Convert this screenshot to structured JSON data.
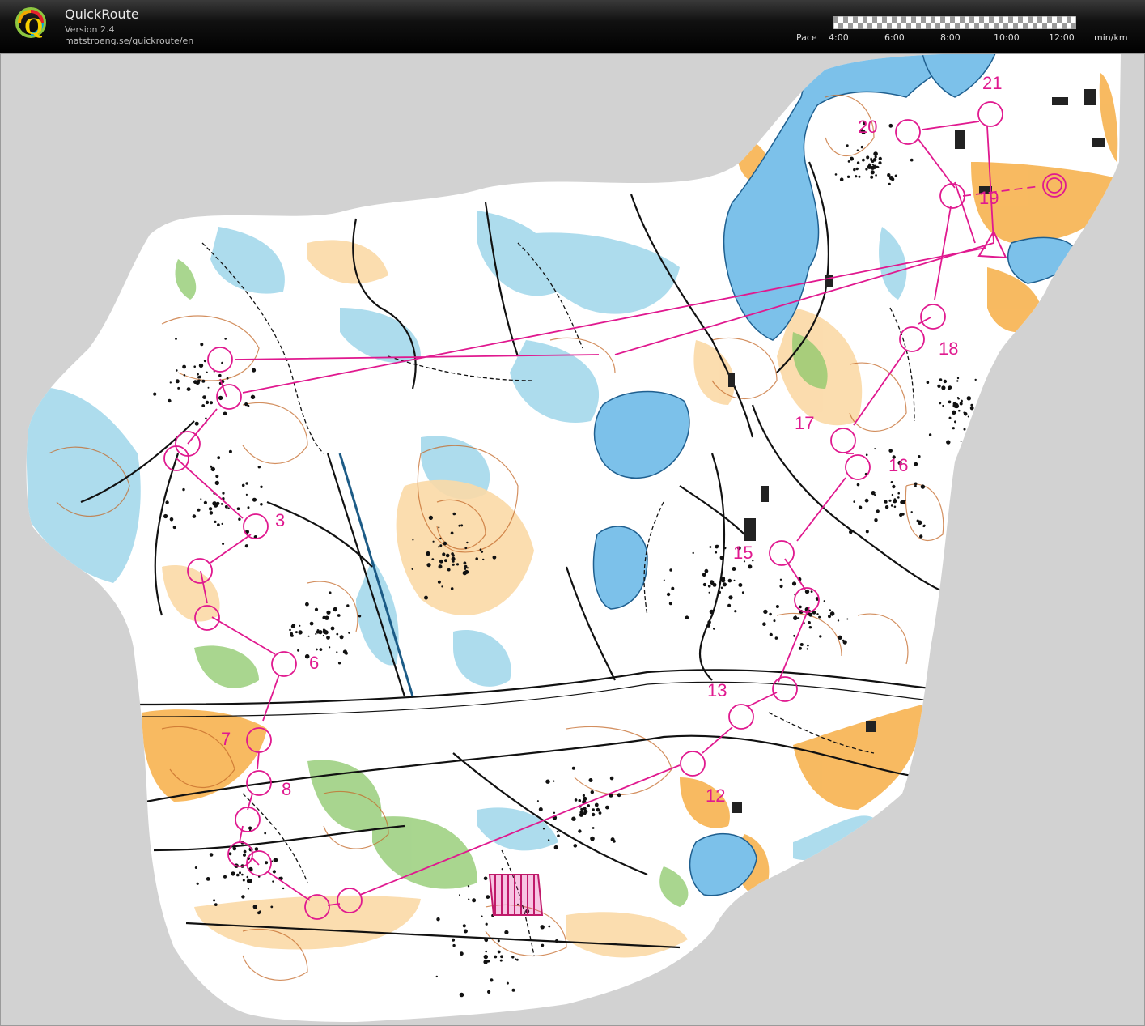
{
  "app": {
    "title": "QuickRoute",
    "version": "Version 2.4",
    "url": "matstroeng.se/quickroute/en"
  },
  "pace_legend": {
    "label": "Pace",
    "ticks": [
      "4:00",
      "6:00",
      "8:00",
      "10:00",
      "12:00"
    ],
    "unit": "min/km"
  },
  "course": {
    "color": "#e0198f",
    "controls": [
      {
        "number": "3"
      },
      {
        "number": "6"
      },
      {
        "number": "7"
      },
      {
        "number": "8"
      },
      {
        "number": "12"
      },
      {
        "number": "13"
      },
      {
        "number": "15"
      },
      {
        "number": "16"
      },
      {
        "number": "17"
      },
      {
        "number": "18"
      },
      {
        "number": "19"
      },
      {
        "number": "20"
      },
      {
        "number": "21"
      }
    ]
  },
  "colors": {
    "water": "#7dbfe8",
    "marsh": "#8fd0e8",
    "open_land": "#f5b04a",
    "vegetation": "#79b35a",
    "contours": "#c46a2a",
    "paths": "#111111",
    "background": "#d2d2d2"
  },
  "icons": {
    "logo": "quickroute-logo",
    "start": "start-triangle",
    "finish": "finish-double-circle"
  }
}
